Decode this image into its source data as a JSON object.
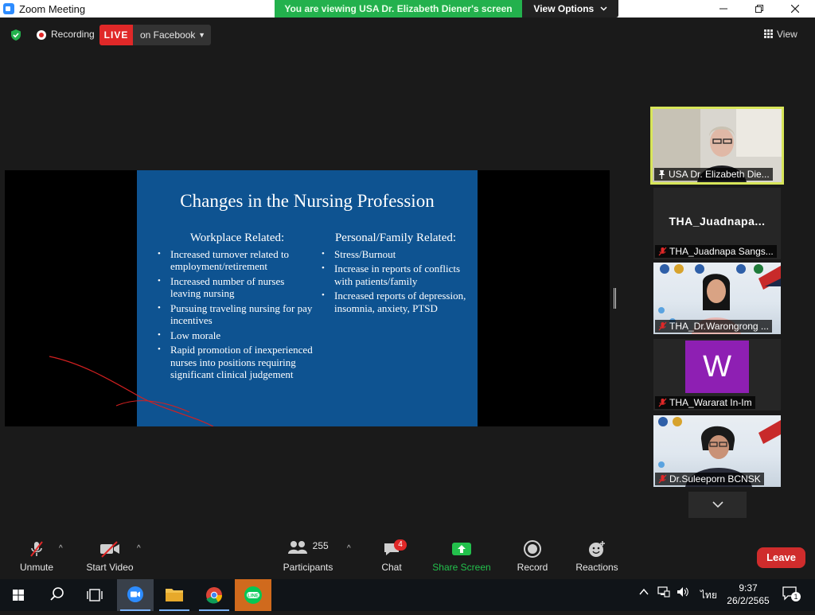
{
  "window": {
    "title": "Zoom Meeting",
    "viewing_banner": "You are viewing USA Dr. Elizabeth Diener's screen",
    "view_options_label": "View Options"
  },
  "meeting_bar": {
    "recording_label": "Recording",
    "live_label": "LIVE",
    "live_destination": "on Facebook",
    "view_label": "View"
  },
  "slide": {
    "title": "Changes in the Nursing Profession",
    "left_heading": "Workplace Related:",
    "left_bullets": [
      "Increased turnover related to employment/retirement",
      "Increased number of nurses leaving nursing",
      "Pursuing traveling nursing for pay incentives",
      "Low morale",
      "Rapid promotion of inexperienced nurses into positions requiring significant clinical judgement"
    ],
    "right_heading": "Personal/Family Related:",
    "right_bullets": [
      "Stress/Burnout",
      "Increase in reports of conflicts with patients/family",
      "Increased reports of depression, insomnia, anxiety, PTSD"
    ]
  },
  "gallery": {
    "participants": [
      {
        "name": "USA Dr. Elizabeth Die...",
        "pinned": true,
        "video": true
      },
      {
        "name": "THA_Juadnapa Sangs...",
        "display_name": "THA_Juadnapa...",
        "muted": true,
        "video": false
      },
      {
        "name": "THA_Dr.Warongrong ...",
        "muted": true,
        "video": true
      },
      {
        "name": "THA_Wararat In-Im",
        "avatar_letter": "W",
        "muted": true,
        "video": false
      },
      {
        "name": "Dr.Suleeporn BCNSK",
        "muted": true,
        "video": true
      }
    ],
    "more_icon": "chevron-down-icon"
  },
  "toolbar": {
    "unmute_label": "Unmute",
    "start_video_label": "Start Video",
    "participants_label": "Participants",
    "participants_count": "255",
    "chat_label": "Chat",
    "chat_badge": "4",
    "share_screen_label": "Share Screen",
    "record_label": "Record",
    "reactions_label": "Reactions",
    "leave_label": "Leave"
  },
  "taskbar": {
    "apps": [
      "windows-start-icon",
      "search-icon",
      "task-view-icon",
      "zoom-icon",
      "file-explorer-icon",
      "chrome-icon",
      "line-icon"
    ],
    "language": "ไทย",
    "time": "9:37",
    "date": "26/2/2565",
    "notification_count": "1"
  },
  "colors": {
    "live_red": "#e02828",
    "banner_green": "#23b14d",
    "share_green": "#23c04c",
    "slide_blue": "#0e5391",
    "active_speaker_border": "#d8e65a",
    "leave_red": "#cf2c2c",
    "avatar_purple": "#8e1fb3"
  }
}
